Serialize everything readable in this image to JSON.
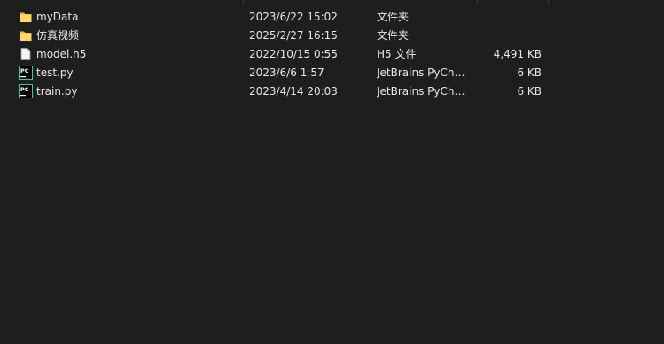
{
  "files": [
    {
      "name": "myData",
      "date": "2023/6/22 15:02",
      "type": "文件夹",
      "size": "",
      "icon": "folder-icon"
    },
    {
      "name": "仿真视频",
      "date": "2025/2/27 16:15",
      "type": "文件夹",
      "size": "",
      "icon": "folder-icon"
    },
    {
      "name": "model.h5",
      "date": "2022/10/15 0:55",
      "type": "H5 文件",
      "size": "4,491 KB",
      "icon": "file-icon"
    },
    {
      "name": "test.py",
      "date": "2023/6/6 1:57",
      "type": "JetBrains PyChar...",
      "size": "6 KB",
      "icon": "pycharm-file-icon"
    },
    {
      "name": "train.py",
      "date": "2023/4/14 20:03",
      "type": "JetBrains PyChar...",
      "size": "6 KB",
      "icon": "pycharm-file-icon"
    }
  ],
  "pycharm_icon_text": "PC"
}
